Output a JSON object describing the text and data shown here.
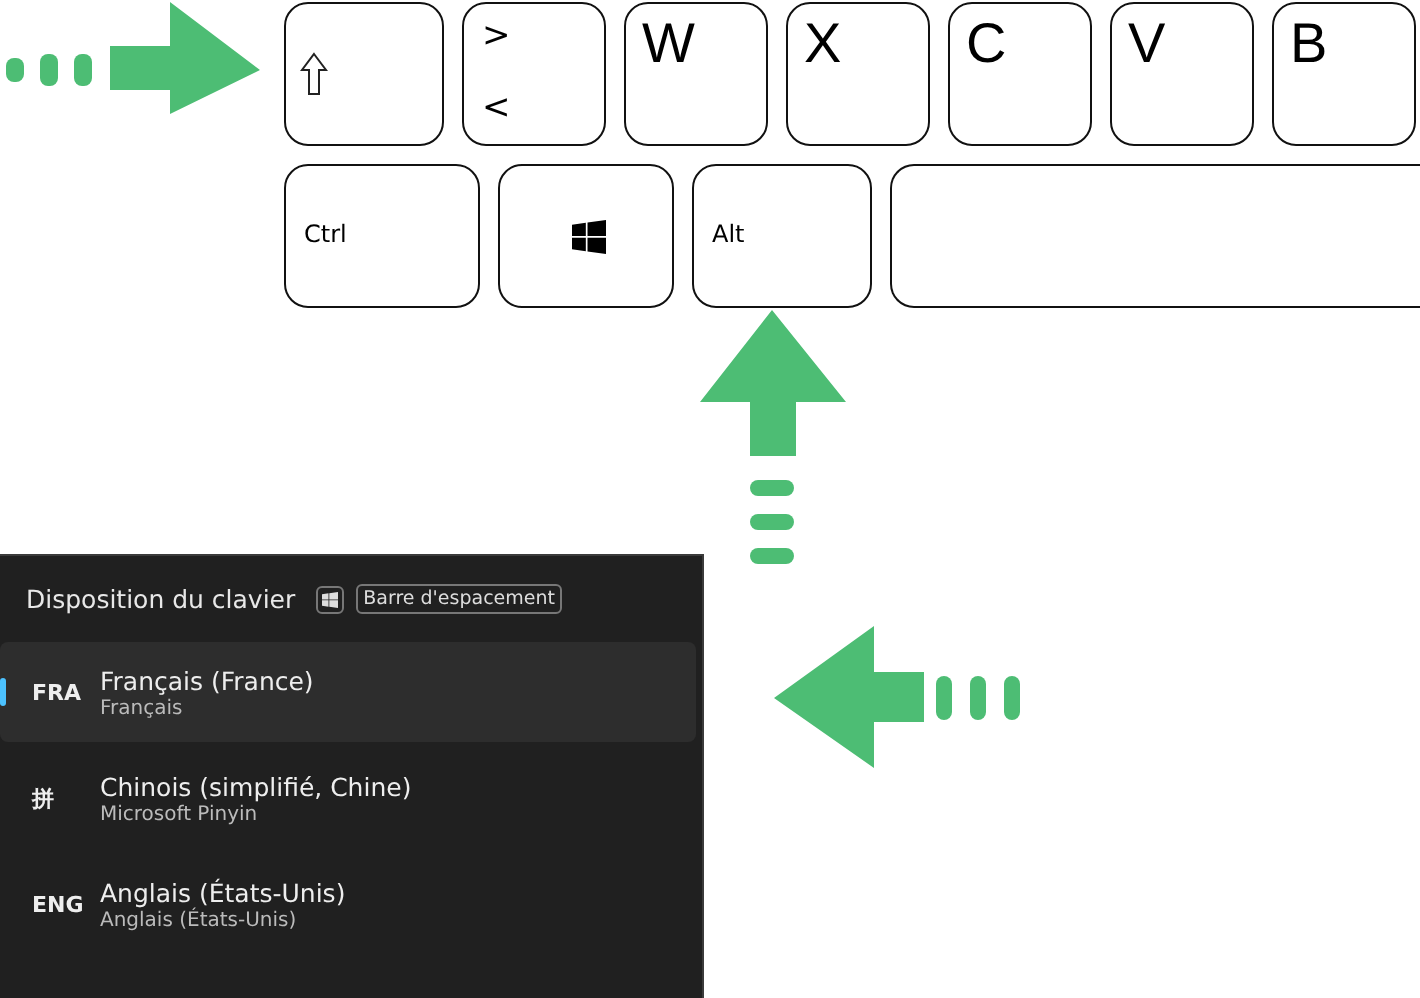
{
  "keyboard": {
    "rows": [
      [
        {
          "kind": "shift"
        },
        {
          "kind": "dual",
          "top": ">",
          "bottom": "<"
        },
        {
          "kind": "letter",
          "label": "W"
        },
        {
          "kind": "letter",
          "label": "X"
        },
        {
          "kind": "letter",
          "label": "C"
        },
        {
          "kind": "letter",
          "label": "V"
        },
        {
          "kind": "letter",
          "label": "B"
        }
      ],
      [
        {
          "kind": "modifier",
          "label": "Ctrl"
        },
        {
          "kind": "windows"
        },
        {
          "kind": "modifier",
          "label": "Alt"
        },
        {
          "kind": "space"
        }
      ]
    ]
  },
  "flyout": {
    "title": "Disposition du clavier",
    "shortcut": "Barre d'espacement",
    "items": [
      {
        "code": "FRA",
        "name": "Français (France)",
        "sub": "Français",
        "selected": true
      },
      {
        "code": "拼",
        "name": "Chinois (simplifié, Chine)",
        "sub": "Microsoft Pinyin",
        "selected": false
      },
      {
        "code": "ENG",
        "name": "Anglais (États-Unis)",
        "sub": "Anglais (États-Unis)",
        "selected": false
      }
    ]
  }
}
